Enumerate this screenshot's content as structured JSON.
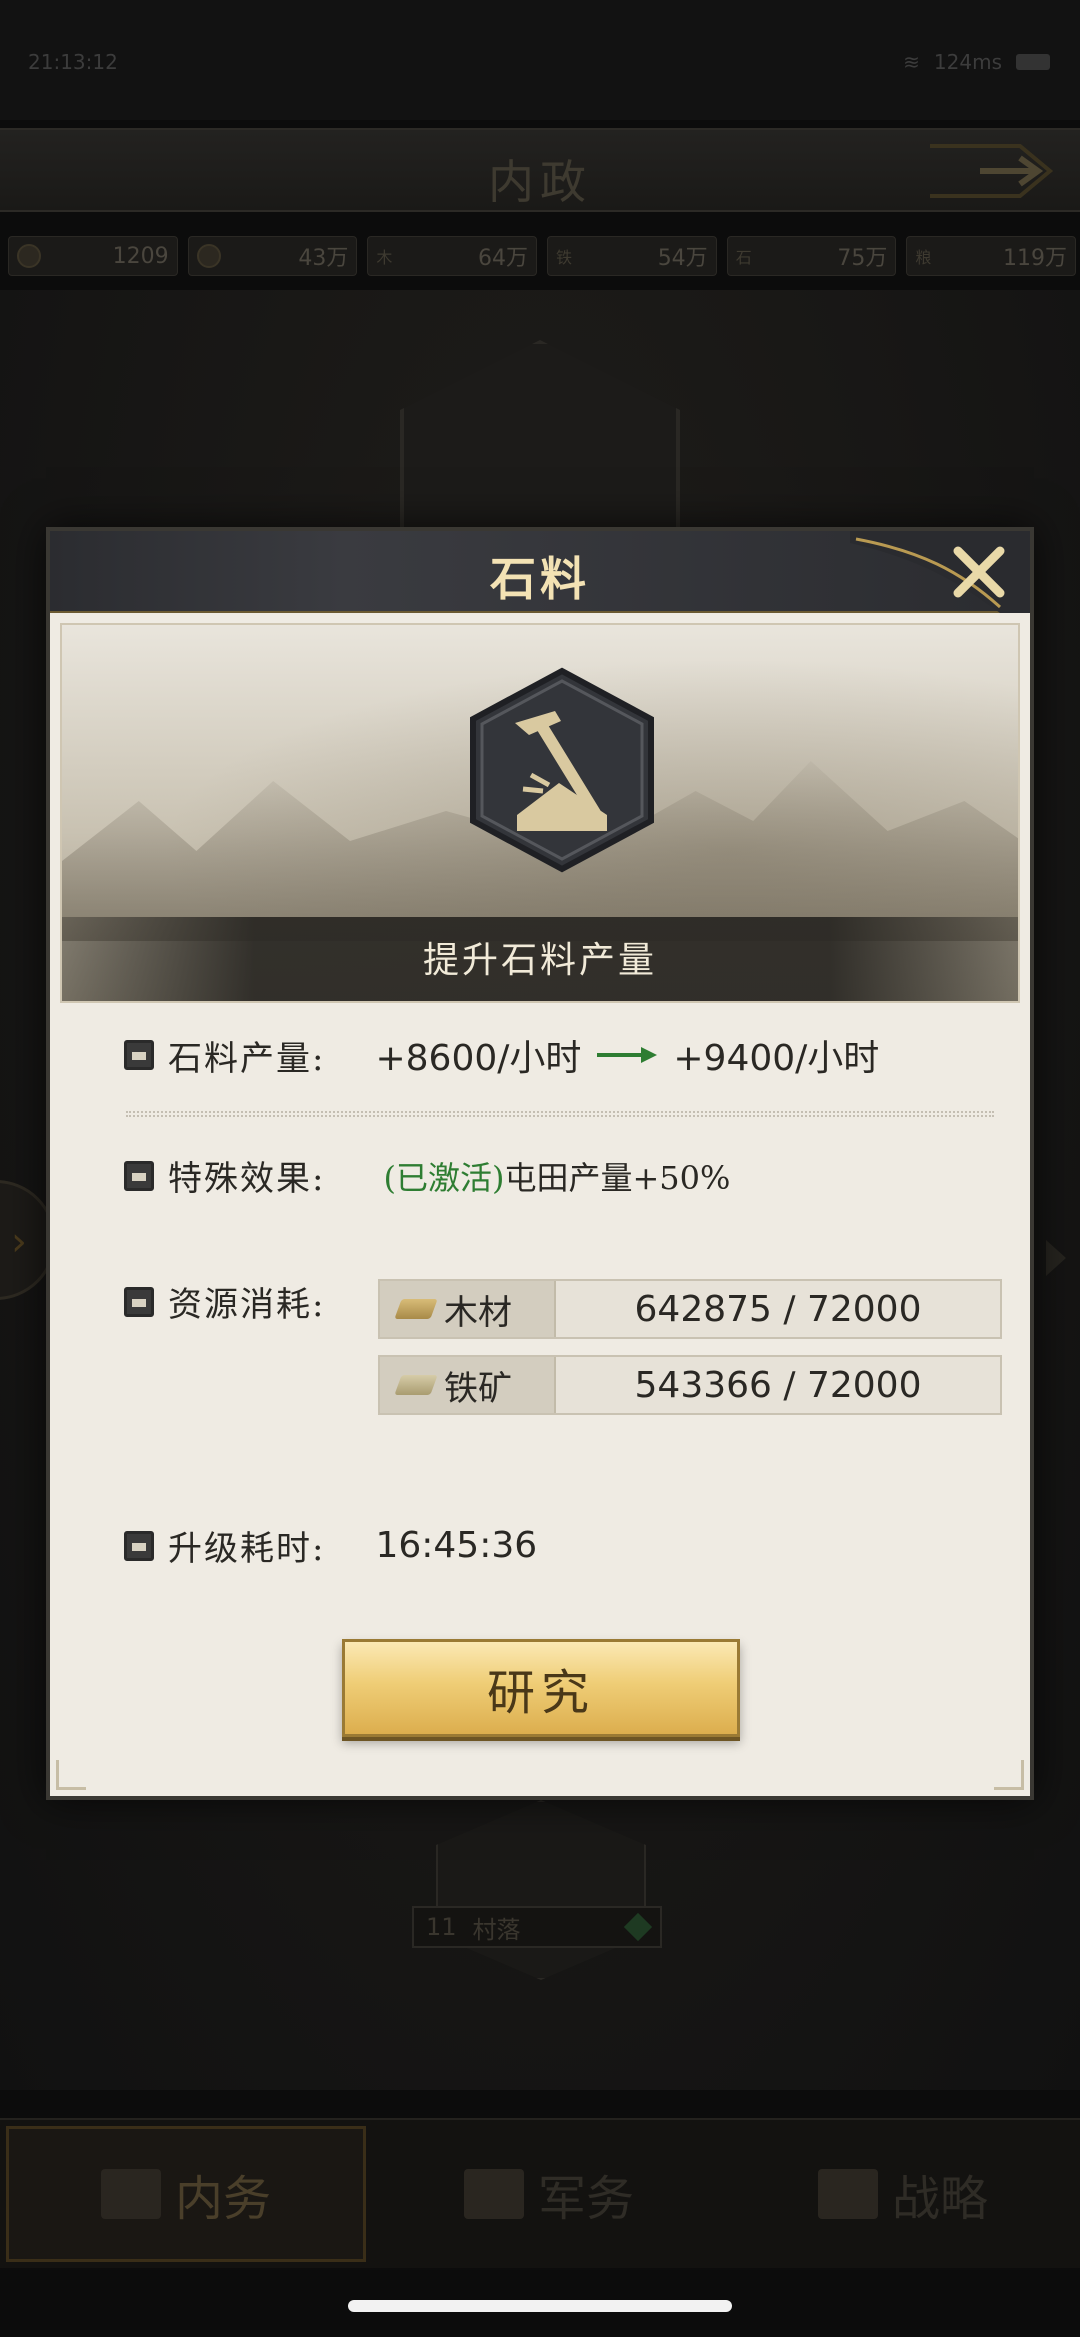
{
  "status_bar": {
    "time": "21:13:12",
    "ping": "124ms"
  },
  "background": {
    "title": "内政",
    "resources": [
      {
        "value": "1209"
      },
      {
        "value": "43万"
      },
      {
        "tag": "木",
        "value": "64万"
      },
      {
        "tag": "铁",
        "value": "54万"
      },
      {
        "tag": "石",
        "value": "75万"
      },
      {
        "tag": "粮",
        "value": "119万"
      }
    ],
    "building": {
      "level": "11",
      "name": "村落"
    },
    "nav": {
      "tab1": "内务",
      "tab2": "军务",
      "tab3": "战略"
    }
  },
  "modal": {
    "title": "石料",
    "banner_caption": "提升石料产量",
    "production": {
      "label": "石料产量:",
      "from": "+8600/小时",
      "to": "+9400/小时"
    },
    "special": {
      "label": "特殊效果:",
      "status": "(已激活)",
      "effect": "屯田产量+50%"
    },
    "cost": {
      "label": "资源消耗:",
      "items": [
        {
          "name": "木材",
          "amount": "642875 / 72000"
        },
        {
          "name": "铁矿",
          "amount": "543366 / 72000"
        }
      ]
    },
    "time": {
      "label": "升级耗时:",
      "value": "16:45:36"
    },
    "research_button": "研究"
  },
  "colors": {
    "accent_gold": "#efcd76",
    "activated_green": "#2e7d32",
    "panel_bg": "#efebe3"
  }
}
